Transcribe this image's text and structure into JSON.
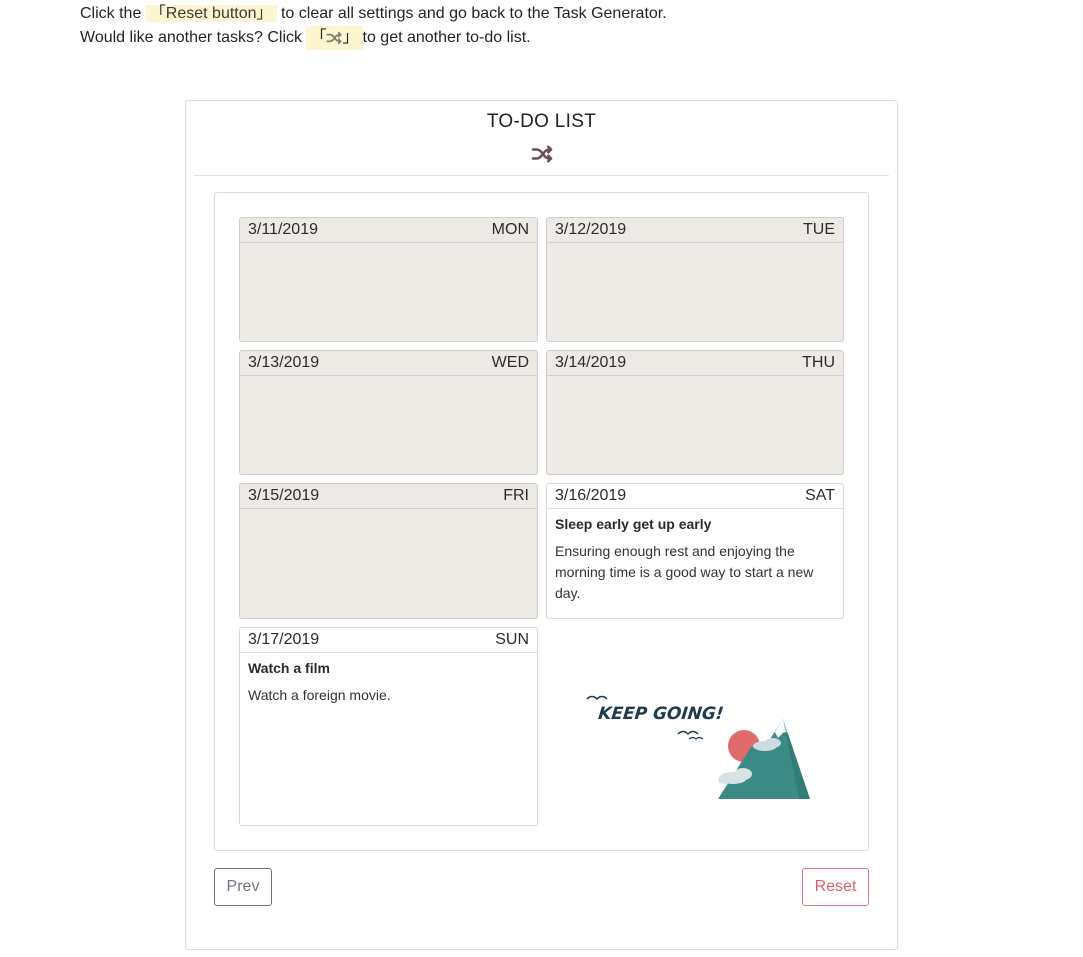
{
  "instructions": {
    "line1_prefix": "Click the ",
    "line1_highlight": "「Reset button」",
    "line1_suffix": " to clear all settings and go back to the Task Generator.",
    "line2_prefix": "Would like another tasks? Click ",
    "line2_bracket_open": "「",
    "line2_bracket_close": "」",
    "line2_suffix": "to get another to-do list."
  },
  "card": {
    "title": "TO-DO LIST",
    "shuffle_icon": "shuffle-icon"
  },
  "days": [
    {
      "date": "3/11/2019",
      "weekday": "MON",
      "task_title": "",
      "task_desc": ""
    },
    {
      "date": "3/12/2019",
      "weekday": "TUE",
      "task_title": "",
      "task_desc": ""
    },
    {
      "date": "3/13/2019",
      "weekday": "WED",
      "task_title": "",
      "task_desc": ""
    },
    {
      "date": "3/14/2019",
      "weekday": "THU",
      "task_title": "",
      "task_desc": ""
    },
    {
      "date": "3/15/2019",
      "weekday": "FRI",
      "task_title": "",
      "task_desc": ""
    },
    {
      "date": "3/16/2019",
      "weekday": "SAT",
      "task_title": "Sleep early get up early",
      "task_desc": "Ensuring enough rest and enjoying the morning time is a good way to start a new day."
    },
    {
      "date": "3/17/2019",
      "weekday": "SUN",
      "task_title": "Watch a film",
      "task_desc": "Watch a foreign movie."
    }
  ],
  "illustration": {
    "text": "KEEP GOING!",
    "colors": {
      "sun": "#e06b6b",
      "mountain": "#3b8a86",
      "text": "#1f3b4d"
    }
  },
  "buttons": {
    "prev_label": "Prev",
    "reset_label": "Reset"
  },
  "colors": {
    "empty_day_bg": "#edeae5",
    "highlight_bg": "#fdf5cf",
    "reset_accent": "#e05c6a",
    "shuffle_icon": "#6b4f55"
  }
}
